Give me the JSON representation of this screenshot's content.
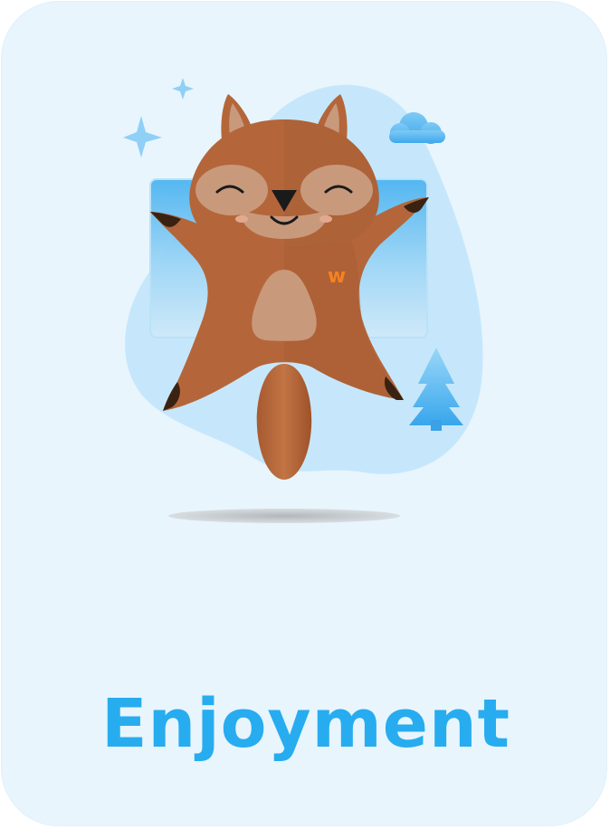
{
  "card": {
    "title": "Enjoyment",
    "badge_letter": "w"
  },
  "illustration": {
    "subject": "flying-squirrel-mascot",
    "decorations": [
      "star-icon",
      "star-icon",
      "cloud-icon",
      "pine-tree-icon",
      "window-icon"
    ]
  },
  "colors": {
    "card_background": "#e8f5fd",
    "title": "#27acf0",
    "blob": "#c6e7fb",
    "fur": "#b4663a",
    "fur_light": "#c9997c",
    "badge": "#f58220"
  }
}
